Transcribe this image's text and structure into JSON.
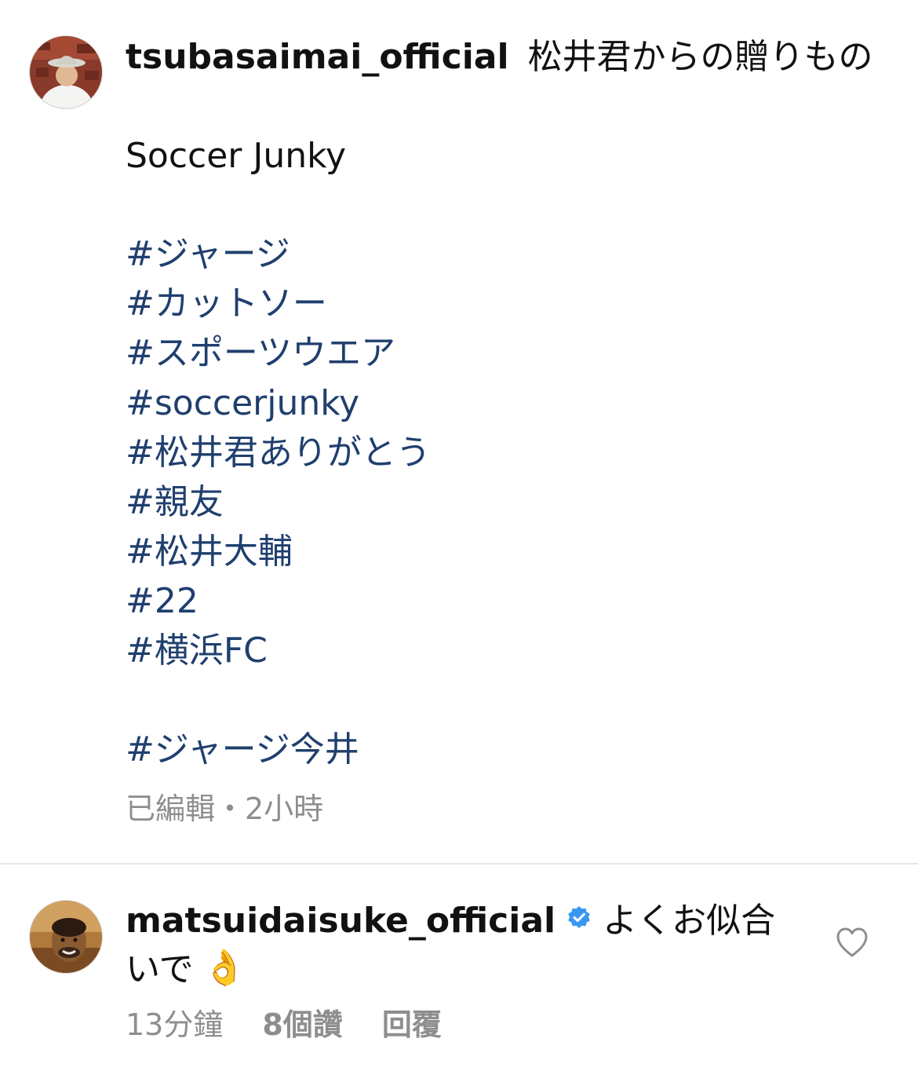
{
  "post": {
    "username": "tsubasaimai_official",
    "caption_title": "松井君からの贈りもの",
    "caption_body": "Soccer Junky",
    "hashtags": [
      "#ジャージ",
      "#カットソー",
      "#スポーツウエア",
      "#soccerjunky",
      "#松井君ありがとう",
      "#親友",
      "#松井大輔",
      "#22",
      "#横浜FC"
    ],
    "last_hashtag": "#ジャージ今井",
    "meta": "已編輯・2小時"
  },
  "comment": {
    "username": "matsuidaisuke_official",
    "text_line1": "よくお似合",
    "text_line2": "いで",
    "emoji": "👌",
    "time": "13分鐘",
    "likes": "8個讚",
    "reply_label": "回覆"
  },
  "icons": {
    "verified": "verified-badge-icon",
    "heart": "heart-outline-icon",
    "emoji": "ok-hand-icon"
  },
  "colors": {
    "hashtag": "#1f3f6e",
    "meta": "#8e8e8e",
    "verified": "#3897f0"
  }
}
